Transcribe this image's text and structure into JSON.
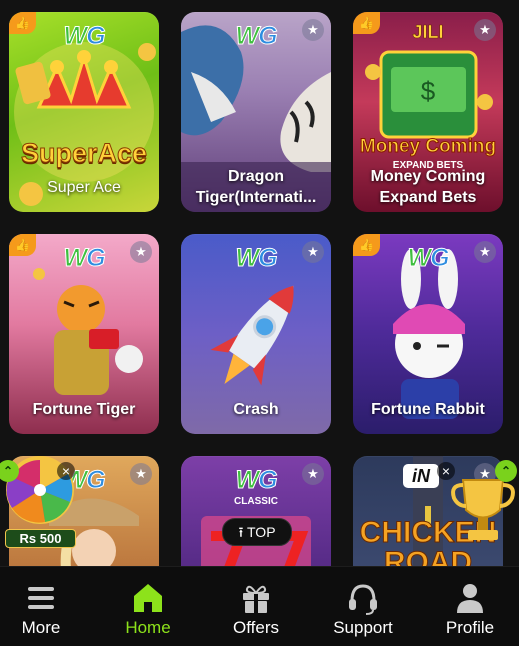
{
  "games": [
    {
      "title": "Super Ace",
      "provider": "WG",
      "art_text": "SuperAce",
      "thumb": true
    },
    {
      "title": "Dragon Tiger(Internati...",
      "provider": "WG",
      "thumb": false
    },
    {
      "title": "Money Coming Expand Bets",
      "provider": "JILI",
      "art_text": "Money Coming",
      "art_sub": "EXPAND BETS",
      "thumb": true
    },
    {
      "title": "Fortune Tiger",
      "provider": "WG",
      "thumb": true
    },
    {
      "title": "Crash",
      "provider": "WG",
      "thumb": false
    },
    {
      "title": "Fortune Rabbit",
      "provider": "WG",
      "thumb": true
    },
    {
      "provider": "WG",
      "thumb": true
    },
    {
      "provider": "WG",
      "thumb": false,
      "art_text": "CLASSIC"
    },
    {
      "provider": "iN",
      "art_text": "CHICKEN ROAD",
      "thumb": false
    }
  ],
  "scroll_top": {
    "label": "TOP"
  },
  "promo": {
    "amount": "Rs 500"
  },
  "nav": {
    "items": [
      {
        "label": "More",
        "icon": "menu-icon"
      },
      {
        "label": "Home",
        "icon": "home-icon",
        "active": true
      },
      {
        "label": "Offers",
        "icon": "gift-icon"
      },
      {
        "label": "Support",
        "icon": "headset-icon"
      },
      {
        "label": "Profile",
        "icon": "person-icon"
      }
    ]
  },
  "colors": {
    "accent": "#8de21b",
    "background": "#121212"
  }
}
